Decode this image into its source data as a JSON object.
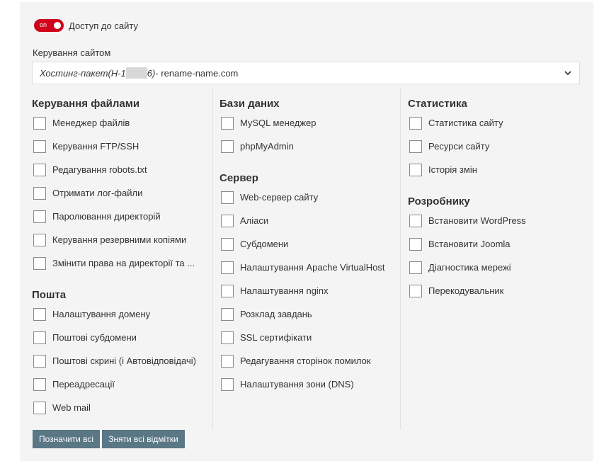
{
  "access": {
    "toggle_state": "on",
    "label": "Доступ до сайту"
  },
  "site_management": {
    "label": "Керування сайтом",
    "selected_prefix": "Хостинг-пакет(Н-1",
    "selected_mid": "6)",
    "selected_suffix": " - rename-name.com"
  },
  "columns": [
    {
      "sections": [
        {
          "title": "Керування файлами",
          "items": [
            "Менеджер файлів",
            "Керування FTP/SSH",
            "Редагування robots.txt",
            "Отримати лог-файли",
            "Паролювання директорій",
            "Керування резервними копіями",
            "Змінити права на директорії та ..."
          ]
        },
        {
          "title": "Пошта",
          "items": [
            "Налаштування домену",
            "Поштові субдомени",
            "Поштові скрині (і Автовідповідачі)",
            "Переадресації",
            "Web mail"
          ]
        }
      ]
    },
    {
      "sections": [
        {
          "title": "Бази даних",
          "items": [
            "MySQL менеджер",
            "phpMyAdmin"
          ]
        },
        {
          "title": "Сервер",
          "items": [
            "Web-сервер сайту",
            "Аліаси",
            "Субдомени",
            "Налаштування Apache VirtualHost",
            "Налаштування nginx",
            "Розклад завдань",
            "SSL сертифікати",
            "Редагування сторінок помилок",
            "Налаштування зони (DNS)"
          ]
        }
      ]
    },
    {
      "sections": [
        {
          "title": "Статистика",
          "items": [
            "Статистика сайту",
            "Ресурси сайту",
            "Історія змін"
          ]
        },
        {
          "title": "Розробнику",
          "items": [
            "Встановити WordPress",
            "Встановити Joomla",
            "Діагностика мережі",
            "Перекодувальник"
          ]
        }
      ]
    }
  ],
  "buttons": {
    "select_all": "Позначити всі",
    "clear_all": "Зняти всі відмітки"
  },
  "colors": {
    "toggle_on": "#d0021b",
    "button_bg": "#5a7785",
    "panel_bg": "#f4f4f4"
  }
}
